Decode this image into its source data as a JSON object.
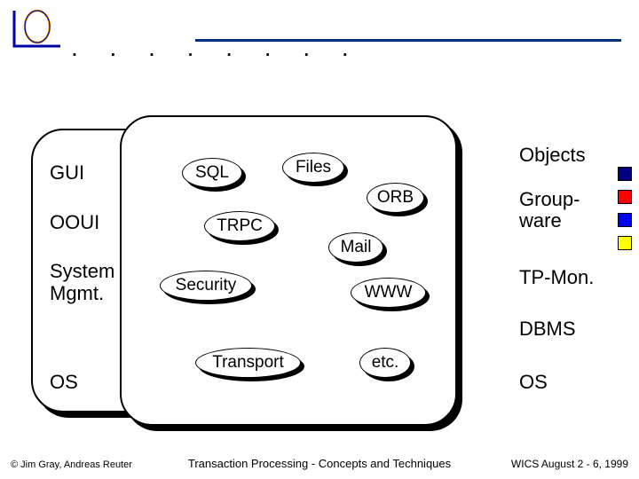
{
  "left": {
    "gui": "GUI",
    "ooui": "OOUI",
    "sysmgmt1": "System",
    "sysmgmt2": "Mgmt.",
    "os": "OS"
  },
  "nodes": {
    "sql": "SQL",
    "files": "Files",
    "trpc": "TRPC",
    "security": "Security",
    "transport": "Transport",
    "orb": "ORB",
    "mail": "Mail",
    "www": "WWW",
    "etc": "etc."
  },
  "right": {
    "objects": "Objects",
    "group1": "Group-",
    "group2": "ware",
    "tpmon": "TP-Mon.",
    "dbms": "DBMS",
    "os": "OS"
  },
  "colors": {
    "c1": "#000080",
    "c2": "#ff0000",
    "c3": "#0000ff",
    "c4": "#ffff00"
  },
  "footer": {
    "left": "© Jim Gray, Andreas Reuter",
    "center": "Transaction Processing - Concepts and Techniques",
    "right": "WICS August 2 - 6, 1999"
  }
}
